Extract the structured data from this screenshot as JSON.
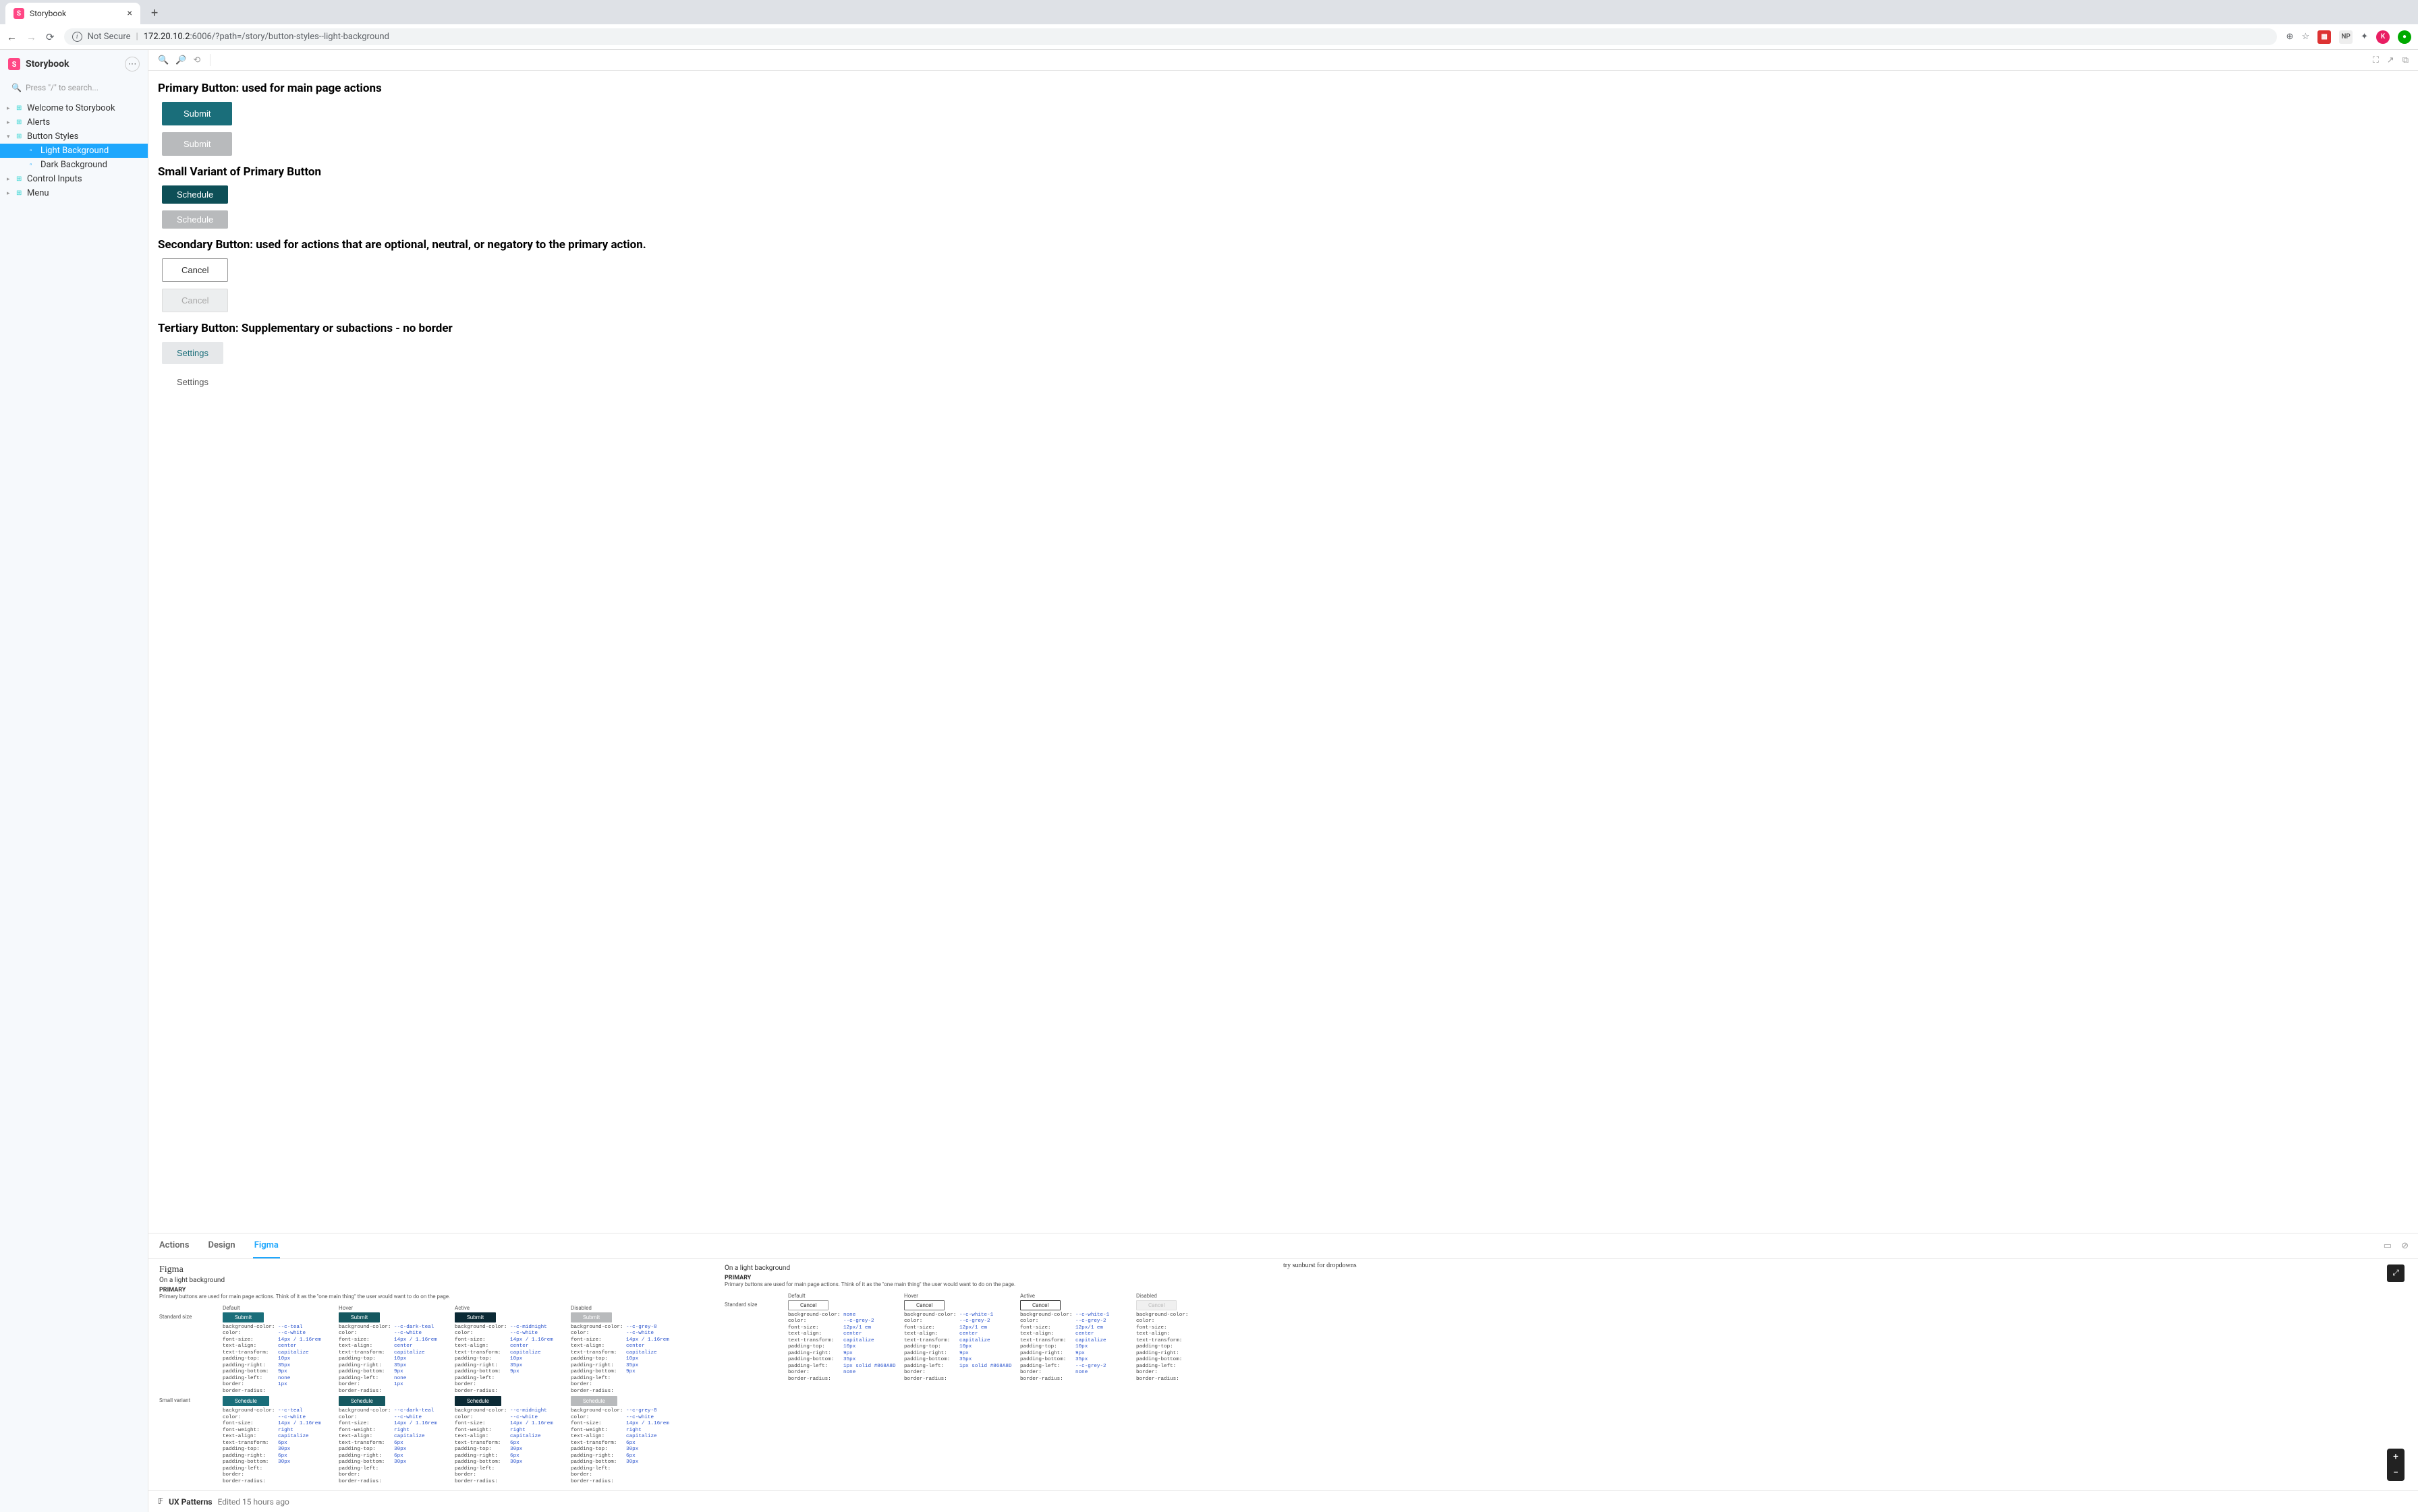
{
  "browser": {
    "tab_title": "Storybook",
    "not_secure": "Not Secure",
    "host_prefix": "172.20.10.2",
    "host_port": ":6006",
    "url_path": "/?path=/story/button-styles--light-background",
    "ext_np": "NP",
    "ext_k": "K"
  },
  "sidebar": {
    "app_name": "Storybook",
    "search_placeholder": "Press \"/\" to search...",
    "items": [
      {
        "label": "Welcome to Storybook",
        "kind": "grid"
      },
      {
        "label": "Alerts",
        "kind": "grid"
      },
      {
        "label": "Button Styles",
        "kind": "grid",
        "expanded": true
      },
      {
        "label": "Light Background",
        "kind": "story",
        "active": true,
        "indent": 1
      },
      {
        "label": "Dark Background",
        "kind": "story",
        "indent": 1
      },
      {
        "label": "Control Inputs",
        "kind": "grid"
      },
      {
        "label": "Menu",
        "kind": "grid"
      }
    ]
  },
  "addons": {
    "tabs": [
      "Actions",
      "Design",
      "Figma"
    ],
    "active": "Figma"
  },
  "canvas": {
    "sections": [
      {
        "heading": "Primary Button: used for main page actions",
        "buttons": [
          {
            "label": "Submit",
            "cls": "primary"
          },
          {
            "label": "Submit",
            "cls": "primary disabled"
          }
        ]
      },
      {
        "heading": "Small Variant of Primary Button",
        "buttons": [
          {
            "label": "Schedule",
            "cls": "primary sm"
          },
          {
            "label": "Schedule",
            "cls": "primary sm disabled"
          }
        ]
      },
      {
        "heading": "Secondary Button: used for actions that are optional, neutral, or negatory to the primary action.",
        "buttons": [
          {
            "label": "Cancel",
            "cls": "secondary"
          },
          {
            "label": "Cancel",
            "cls": "secondary disabled"
          }
        ]
      },
      {
        "heading": "Tertiary Button: Supplementary or subactions - no border",
        "buttons": [
          {
            "label": "Settings",
            "cls": "tertiary"
          },
          {
            "label": "Settings",
            "cls": "tertiary plain"
          }
        ]
      }
    ]
  },
  "figma": {
    "brand": "Figma",
    "note": "try sunburst for dropdowns",
    "footer_name": "UX Patterns",
    "footer_edited": "Edited 15 hours ago",
    "left": {
      "subtitle": "On a light background",
      "group": "PRIMARY",
      "desc": "Primary buttons are used for main page actions. Think of it as the \"one main thing\" the user would want to do on the page.",
      "col_headers": [
        "Default",
        "Hover",
        "Active",
        "Disabled"
      ],
      "rows": [
        {
          "label": "Standard size",
          "cells": [
            {
              "btn_label": "Submit",
              "btn_cls": "teal",
              "props": [
                [
                  "background-color:",
                  "--c-teal"
                ],
                [
                  "color:",
                  "--c-white"
                ],
                [
                  "font-size:",
                  "14px / 1.16rem"
                ],
                [
                  "text-align:",
                  "center"
                ],
                [
                  "text-transform:",
                  "capitalize"
                ],
                [
                  "padding-top:",
                  "10px"
                ],
                [
                  "padding-right:",
                  "35px"
                ],
                [
                  "padding-bottom:",
                  "9px"
                ],
                [
                  "padding-left:",
                  "none"
                ],
                [
                  "border:",
                  "1px"
                ],
                [
                  "border-radius:",
                  ""
                ]
              ]
            },
            {
              "btn_label": "Submit",
              "btn_cls": "dteal",
              "props": [
                [
                  "background-color:",
                  "--c-dark-teal"
                ],
                [
                  "color:",
                  "--c-white"
                ],
                [
                  "font-size:",
                  "14px / 1.16rem"
                ],
                [
                  "text-align:",
                  "center"
                ],
                [
                  "text-transform:",
                  "capitalize"
                ],
                [
                  "padding-top:",
                  "10px"
                ],
                [
                  "padding-right:",
                  "35px"
                ],
                [
                  "padding-bottom:",
                  "9px"
                ],
                [
                  "padding-left:",
                  "none"
                ],
                [
                  "border:",
                  "1px"
                ],
                [
                  "border-radius:",
                  ""
                ]
              ]
            },
            {
              "btn_label": "Submit",
              "btn_cls": "mid",
              "props": [
                [
                  "background-color:",
                  "--c-midnight"
                ],
                [
                  "color:",
                  "--c-white"
                ],
                [
                  "font-size:",
                  "14px / 1.16rem"
                ],
                [
                  "text-align:",
                  "center"
                ],
                [
                  "text-transform:",
                  "capitalize"
                ],
                [
                  "padding-top:",
                  "10px"
                ],
                [
                  "padding-right:",
                  "35px"
                ],
                [
                  "padding-bottom:",
                  "9px"
                ],
                [
                  "padding-left:",
                  ""
                ],
                [
                  "border:",
                  ""
                ],
                [
                  "border-radius:",
                  ""
                ]
              ]
            },
            {
              "btn_label": "Submit",
              "btn_cls": "grey",
              "props": [
                [
                  "background-color:",
                  "--c-grey-8"
                ],
                [
                  "color:",
                  "--c-white"
                ],
                [
                  "font-size:",
                  "14px / 1.16rem"
                ],
                [
                  "text-align:",
                  "center"
                ],
                [
                  "text-transform:",
                  "capitalize"
                ],
                [
                  "padding-top:",
                  "10px"
                ],
                [
                  "padding-right:",
                  "35px"
                ],
                [
                  "padding-bottom:",
                  "9px"
                ],
                [
                  "padding-left:",
                  ""
                ],
                [
                  "border:",
                  ""
                ],
                [
                  "border-radius:",
                  ""
                ]
              ]
            }
          ]
        },
        {
          "label": "Small variant",
          "cells": [
            {
              "btn_label": "Schedule",
              "btn_cls": "teal",
              "props": [
                [
                  "background-color:",
                  "--c-teal"
                ],
                [
                  "color:",
                  "--c-white"
                ],
                [
                  "font-size:",
                  "14px / 1.16rem"
                ],
                [
                  "font-weight:",
                  "right"
                ],
                [
                  "text-align:",
                  "capitalize"
                ],
                [
                  "text-transform:",
                  "6px"
                ],
                [
                  "padding-top:",
                  "30px"
                ],
                [
                  "padding-right:",
                  "6px"
                ],
                [
                  "padding-bottom:",
                  "30px"
                ],
                [
                  "padding-left:",
                  ""
                ],
                [
                  "border:",
                  ""
                ],
                [
                  "border-radius:",
                  ""
                ]
              ]
            },
            {
              "btn_label": "Schedule",
              "btn_cls": "dteal",
              "props": [
                [
                  "background-color:",
                  "--c-dark-teal"
                ],
                [
                  "color:",
                  "--c-white"
                ],
                [
                  "font-size:",
                  "14px / 1.16rem"
                ],
                [
                  "font-weight:",
                  "right"
                ],
                [
                  "text-align:",
                  "capitalize"
                ],
                [
                  "text-transform:",
                  "6px"
                ],
                [
                  "padding-top:",
                  "30px"
                ],
                [
                  "padding-right:",
                  "6px"
                ],
                [
                  "padding-bottom:",
                  "30px"
                ],
                [
                  "padding-left:",
                  ""
                ],
                [
                  "border:",
                  ""
                ],
                [
                  "border-radius:",
                  ""
                ]
              ]
            },
            {
              "btn_label": "Schedule",
              "btn_cls": "mid",
              "props": [
                [
                  "background-color:",
                  "--c-midnight"
                ],
                [
                  "color:",
                  "--c-white"
                ],
                [
                  "font-size:",
                  "14px / 1.16rem"
                ],
                [
                  "font-weight:",
                  "right"
                ],
                [
                  "text-align:",
                  "capitalize"
                ],
                [
                  "text-transform:",
                  "6px"
                ],
                [
                  "padding-top:",
                  "30px"
                ],
                [
                  "padding-right:",
                  "6px"
                ],
                [
                  "padding-bottom:",
                  "30px"
                ],
                [
                  "padding-left:",
                  ""
                ],
                [
                  "border:",
                  ""
                ],
                [
                  "border-radius:",
                  ""
                ]
              ]
            },
            {
              "btn_label": "Schedule",
              "btn_cls": "grey",
              "props": [
                [
                  "background-color:",
                  "--c-grey-8"
                ],
                [
                  "color:",
                  "--c-white"
                ],
                [
                  "font-size:",
                  "14px / 1.16rem"
                ],
                [
                  "font-weight:",
                  "right"
                ],
                [
                  "text-align:",
                  "capitalize"
                ],
                [
                  "text-transform:",
                  "6px"
                ],
                [
                  "padding-top:",
                  "30px"
                ],
                [
                  "padding-right:",
                  "6px"
                ],
                [
                  "padding-bottom:",
                  "30px"
                ],
                [
                  "padding-left:",
                  ""
                ],
                [
                  "border:",
                  ""
                ],
                [
                  "border-radius:",
                  ""
                ]
              ]
            }
          ]
        }
      ]
    },
    "right": {
      "subtitle": "On a light background",
      "group": "PRIMARY",
      "desc": "Primary buttons are used for main page actions. Think of it as the \"one main thing\" the user would want to do on the page.",
      "col_headers": [
        "Default",
        "Hover",
        "Active",
        "Disabled"
      ],
      "rows": [
        {
          "label": "Standard size",
          "cells": [
            {
              "btn_label": "Cancel",
              "btn_cls": "out",
              "props": [
                [
                  "background-color:",
                  "none"
                ],
                [
                  "color:",
                  "--c-grey-2"
                ],
                [
                  "font-size:",
                  "12px/1 em"
                ],
                [
                  "text-align:",
                  "center"
                ],
                [
                  "text-transform:",
                  "capitalize"
                ],
                [
                  "padding-top:",
                  "10px"
                ],
                [
                  "padding-right:",
                  "9px"
                ],
                [
                  "padding-bottom:",
                  "35px"
                ],
                [
                  "padding-left:",
                  "1px solid #868A8D"
                ],
                [
                  "border:",
                  "none"
                ],
                [
                  "border-radius:",
                  ""
                ]
              ]
            },
            {
              "btn_label": "Cancel",
              "btn_cls": "out h",
              "props": [
                [
                  "background-color:",
                  "--c-white-1"
                ],
                [
                  "color:",
                  "--c-grey-2"
                ],
                [
                  "font-size:",
                  "12px/1 em"
                ],
                [
                  "text-align:",
                  "center"
                ],
                [
                  "text-transform:",
                  "capitalize"
                ],
                [
                  "padding-top:",
                  "10px"
                ],
                [
                  "padding-right:",
                  "9px"
                ],
                [
                  "padding-bottom:",
                  "35px"
                ],
                [
                  "padding-left:",
                  "1px solid #868A8D"
                ],
                [
                  "border:",
                  ""
                ],
                [
                  "border-radius:",
                  ""
                ]
              ]
            },
            {
              "btn_label": "Cancel",
              "btn_cls": "out a",
              "props": [
                [
                  "background-color:",
                  "--c-white-1"
                ],
                [
                  "color:",
                  "--c-grey-2"
                ],
                [
                  "font-size:",
                  "12px/1 em"
                ],
                [
                  "text-align:",
                  "center"
                ],
                [
                  "text-transform:",
                  "capitalize"
                ],
                [
                  "padding-top:",
                  "10px"
                ],
                [
                  "padding-right:",
                  "9px"
                ],
                [
                  "padding-bottom:",
                  "35px"
                ],
                [
                  "padding-left:",
                  "--c-grey-2"
                ],
                [
                  "border:",
                  "none"
                ],
                [
                  "border-radius:",
                  ""
                ]
              ]
            },
            {
              "btn_label": "Cancel",
              "btn_cls": "out d",
              "props": [
                [
                  "background-color:",
                  ""
                ],
                [
                  "color:",
                  ""
                ],
                [
                  "font-size:",
                  ""
                ],
                [
                  "text-align:",
                  ""
                ],
                [
                  "text-transform:",
                  ""
                ],
                [
                  "padding-top:",
                  ""
                ],
                [
                  "padding-right:",
                  ""
                ],
                [
                  "padding-bottom:",
                  ""
                ],
                [
                  "padding-left:",
                  ""
                ],
                [
                  "border:",
                  ""
                ],
                [
                  "border-radius:",
                  ""
                ]
              ]
            }
          ]
        }
      ]
    }
  }
}
